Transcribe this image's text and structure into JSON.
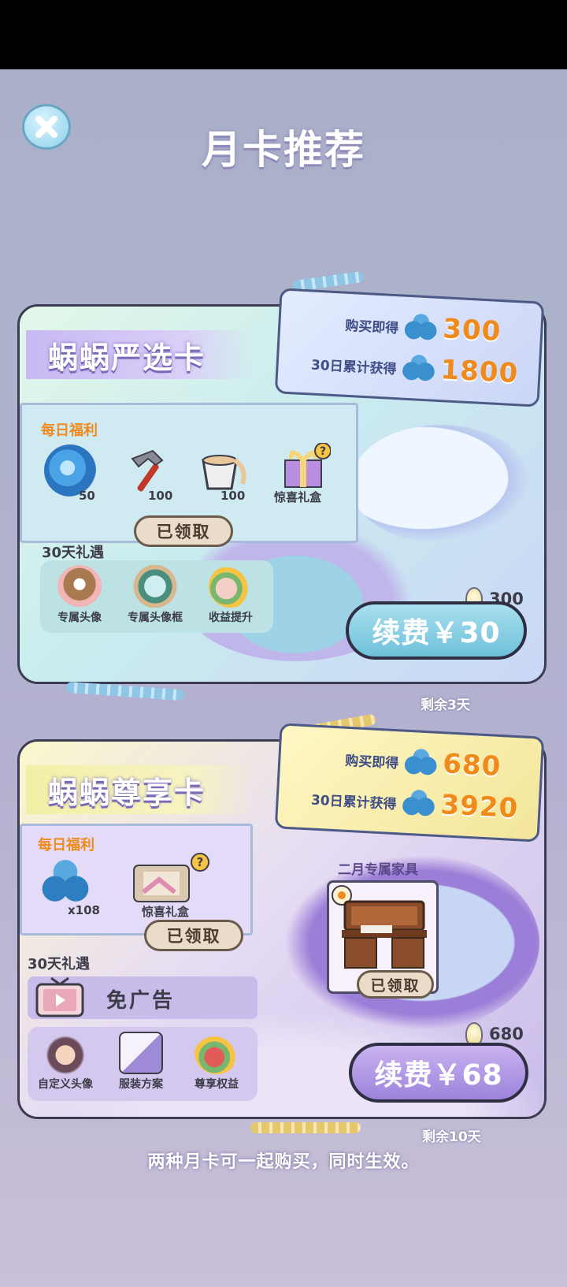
{
  "page": {
    "title": "月卡推荐",
    "footnote": "两种月卡可一起购买，同时生效。",
    "close_label": "✕"
  },
  "cards": [
    {
      "title": "蜗蜗严选卡",
      "buy_label": "购买即得",
      "buy_value": "300",
      "accum_label": "30日累计获得",
      "accum_value": "1800",
      "daily_label": "每日福利",
      "daily_items": [
        {
          "icon": "swirl-orb-icon",
          "qty": "50"
        },
        {
          "icon": "hammer-icon",
          "qty": "100"
        },
        {
          "icon": "paint-bucket-icon",
          "qty": "100"
        },
        {
          "icon": "gift-box-icon",
          "qty": "惊喜礼盒"
        }
      ],
      "claimed_label": "已领取",
      "gift_label": "30天礼遇",
      "gifts": [
        {
          "icon": "owl-avatar-icon",
          "label": "专属头像"
        },
        {
          "icon": "avatar-frame-icon",
          "label": "专属头像框"
        },
        {
          "icon": "income-boost-icon",
          "label": "收益提升"
        }
      ],
      "bulb_value": "300",
      "renew_label": "续费￥30",
      "remaining": "剩余3天"
    },
    {
      "title": "蜗蜗尊享卡",
      "buy_label": "购买即得",
      "buy_value": "680",
      "accum_label": "30日累计获得",
      "accum_value": "3920",
      "daily_label": "每日福利",
      "daily_items": [
        {
          "icon": "cloud-coins-icon",
          "qty": "x108"
        },
        {
          "icon": "surprise-box-icon",
          "qty": "惊喜礼盒"
        }
      ],
      "claimed_label": "已领取",
      "gift_label": "30天礼遇",
      "no_ads_label": "免广告",
      "gifts": [
        {
          "icon": "custom-avatar-icon",
          "label": "自定义头像"
        },
        {
          "icon": "outfit-icon",
          "label": "服装方案"
        },
        {
          "icon": "vip-rights-icon",
          "label": "尊享权益"
        }
      ],
      "furniture_label": "二月专属家具",
      "furniture_claimed": "已领取",
      "bulb_value": "680",
      "renew_label": "续费￥68",
      "remaining": "剩余10天"
    }
  ],
  "colors": {
    "accent_orange": "#f08a1a",
    "ribbon_blue": "#3e4d86",
    "renew_teal": "#8fd3e6",
    "renew_purple": "#b59be6"
  }
}
